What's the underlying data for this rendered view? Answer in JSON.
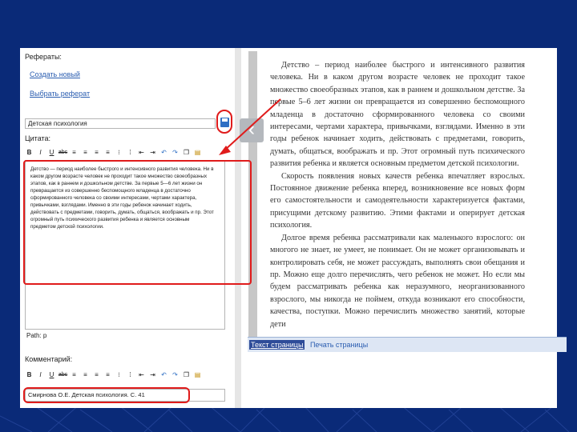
{
  "left": {
    "referaty_label": "Рефераты:",
    "create_new": "Создать новый",
    "choose_referat": "Выбрать реферат",
    "topic_value": "Детская психология",
    "quote_label": "Цитата:",
    "quote_text": "Детство — период наиболее быстрого и интенсивного развития человека. Ни в каком другом возрасте человек не проходит такое множество своеобразных этапов, как в раннем и дошкольном детстве. За первые 5—6 лет жизни он превращается из совершенно беспомощного младенца в достаточно сформированного человека со своими интересами, чертами характера, привычками, взглядами. Именно в эти годы ребенок начинает ходить, действовать с предметами, говорить, думать, общаться, воображать и пр. Этот огромный путь психического развития ребенка и является основным предметом детской психологии.",
    "path_label": "Path: p",
    "comment_label": "Комментарий:",
    "comment_value": "Смирнова О.Е. Детская психология. С. 41"
  },
  "toolbar": {
    "bold": "B",
    "italic": "I",
    "underline": "U",
    "strike": "abc"
  },
  "scan": {
    "paragraphs": [
      "Детство – период наиболее быстрого и интенсивного развития человека. Ни в каком другом возрасте человек не проходит такое множество своеобразных этапов, как в раннем и дошкольном детстве. За первые 5–6 лет жизни он превращается из совершенно беспомощного младенца в достаточно сформированного человека со своими интересами, чертами характера, привычками, взглядами. Именно в эти годы ребенок начинает ходить, действовать с предметами, говорить, думать, общаться, воображать и пр. Этот огромный путь психического развития ребенка и является основным предметом детской психологии.",
      "Скорость появления новых качеств ребенка впечатляет взрослых. Постоянное движение ребенка вперед, возникновение все новых форм его самостоятельности и самодеятельности характеризуется фактами, присущими детскому развитию. Этими фактами и оперирует детская психология.",
      "Долгое время ребенка рассматривали как маленького взрослого: он многого не знает, не умеет, не понимает. Он не может организовывать и контролировать себя, не может рассуждать, выполнять свои обещания и пр. Можно еще долго перечислять, чего ребенок не может. Но если мы будем рассматривать ребенка как неразумного, неорганизованного взрослого, мы никогда не поймем, откуда возникают его способности, качества, поступки. Можно перечислить множество занятий, которые дети"
    ],
    "tab_text": "Текст страницы",
    "tab_print": "Печать страницы",
    "prev": "‹"
  },
  "colors": {
    "background": "#0a2a78",
    "highlight": "#e01b1b",
    "link": "#2a5db0"
  }
}
